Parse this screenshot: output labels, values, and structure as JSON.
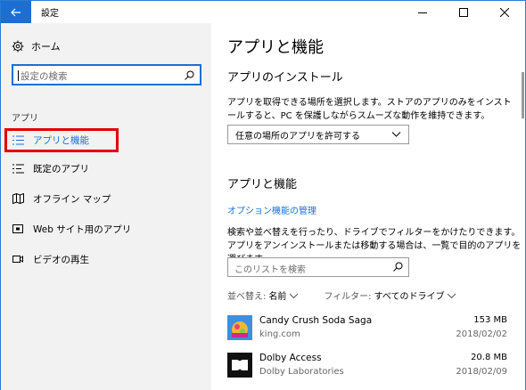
{
  "window": {
    "title": "設定"
  },
  "sidebar": {
    "home_label": "ホーム",
    "search_placeholder": "設定の検索",
    "section_label": "アプリ",
    "items": [
      {
        "label": "アプリと機能",
        "icon": "list-icon"
      },
      {
        "label": "既定のアプリ",
        "icon": "default-apps-icon"
      },
      {
        "label": "オフライン マップ",
        "icon": "map-icon"
      },
      {
        "label": "Web サイト用のアプリ",
        "icon": "web-apps-icon"
      },
      {
        "label": "ビデオの再生",
        "icon": "video-icon"
      }
    ]
  },
  "main": {
    "title": "アプリと機能",
    "install_heading": "アプリのインストール",
    "install_description": "アプリを取得できる場所を選択します。ストアのアプリのみをインストールすると、PC を保護しながらスムーズな動作を維持できます。",
    "install_dropdown_value": "任意の場所のアプリを許可する",
    "features_heading": "アプリと機能",
    "manage_link": "オプション機能の管理",
    "features_description": "検索や並べ替えを行ったり、ドライブでフィルターをかけたりできます。アプリをアンインストールまたは移動する場合は、一覧で目的のアプリを選びます。",
    "list_search_placeholder": "このリストを検索",
    "sort_label": "並べ替え:",
    "sort_value": "名前",
    "filter_label": "フィルター:",
    "filter_value": "すべてのドライブ",
    "apps": [
      {
        "name": "Candy Crush Soda Saga",
        "publisher": "king.com",
        "size": "153 MB",
        "date": "2018/02/02"
      },
      {
        "name": "Dolby Access",
        "publisher": "Dolby Laboratories",
        "size": "20.8 MB",
        "date": "2018/02/09"
      }
    ]
  },
  "colors": {
    "accent": "#1c6fd1",
    "highlight_box": "#e00000",
    "sidebar_bg": "#f2f2f2"
  }
}
